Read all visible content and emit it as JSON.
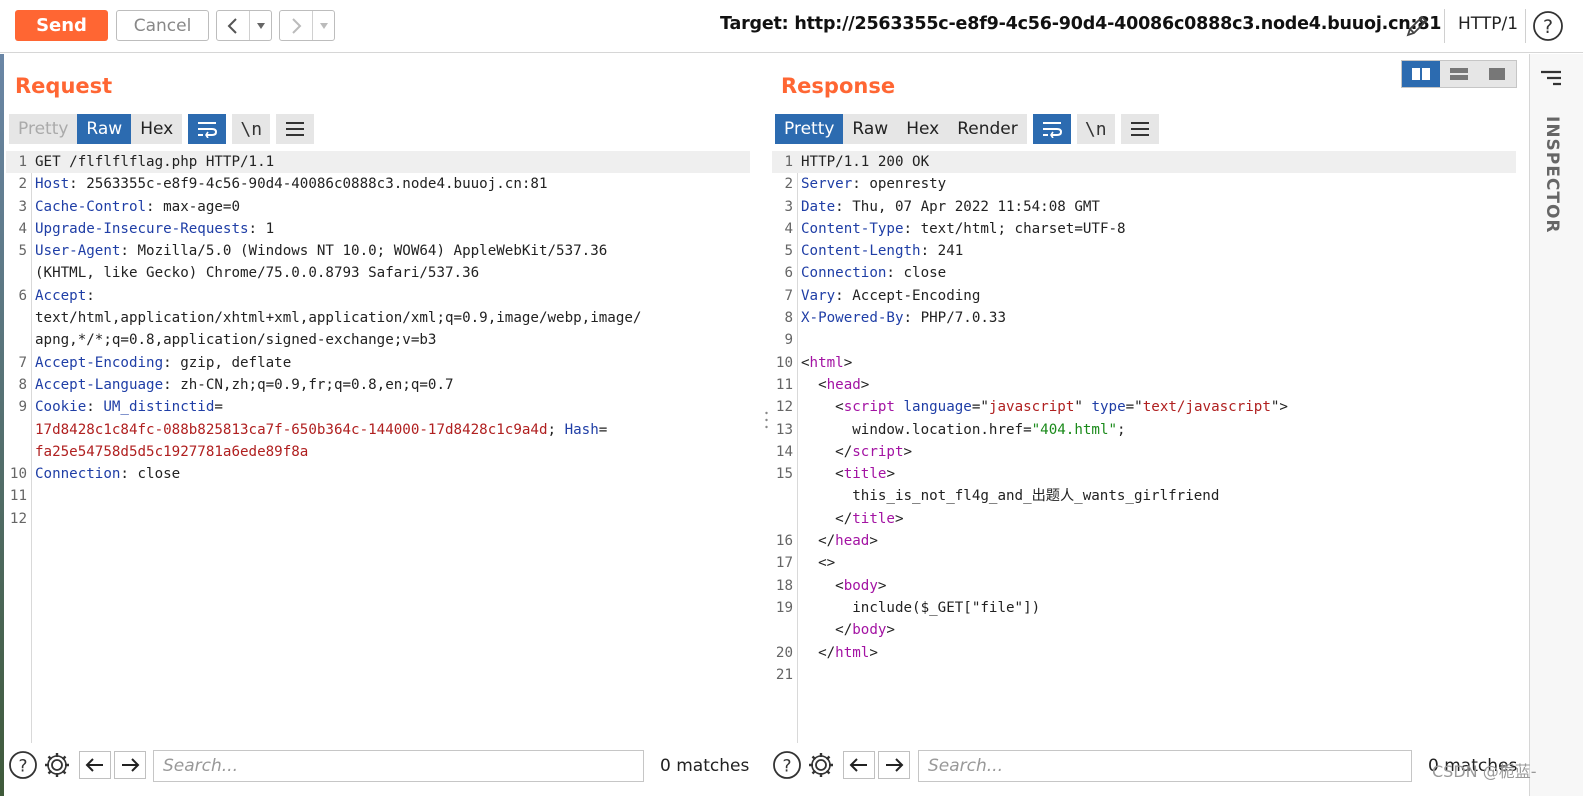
{
  "toolbar": {
    "send_label": "Send",
    "cancel_label": "Cancel",
    "target_label": "Target: http://2563355c-e8f9-4c56-90d4-40086c0888c3.node4.buuoj.cn:81",
    "http_version": "HTTP/1",
    "back_icon": "chevron-left-icon",
    "forward_icon": "chevron-right-icon",
    "edit_icon": "pencil-icon",
    "help_icon": "help-icon"
  },
  "colors": {
    "accent": "#ff6633",
    "active_tab": "#2c6bb0",
    "header_key": "#1f3ea6",
    "cookie_value": "#b02020",
    "tag": "#a313a3",
    "string": "#1a8a1a"
  },
  "request": {
    "title": "Request",
    "tabs": [
      "Pretty",
      "Raw",
      "Hex"
    ],
    "lines": [
      {
        "n": "1",
        "plain": "GET /flflflflag.php HTTP/1.1"
      },
      {
        "n": "2",
        "key": "Host",
        "val": ": 2563355c-e8f9-4c56-90d4-40086c0888c3.node4.buuoj.cn:81"
      },
      {
        "n": "3",
        "key": "Cache-Control",
        "val": ": max-age=0"
      },
      {
        "n": "4",
        "key": "Upgrade-Insecure-Requests",
        "val": ": 1"
      },
      {
        "n": "5",
        "key": "User-Agent",
        "val": ": Mozilla/5.0 (Windows NT 10.0; WOW64) AppleWebKit/537.36"
      },
      {
        "n": "",
        "plain": "(KHTML, like Gecko) Chrome/75.0.0.8793 Safari/537.36"
      },
      {
        "n": "6",
        "key": "Accept",
        "val": ":"
      },
      {
        "n": "",
        "plain": "text/html,application/xhtml+xml,application/xml;q=0.9,image/webp,image/"
      },
      {
        "n": "",
        "plain": "apng,*/*;q=0.8,application/signed-exchange;v=b3"
      },
      {
        "n": "7",
        "key": "Accept-Encoding",
        "val": ": gzip, deflate"
      },
      {
        "n": "8",
        "key": "Accept-Language",
        "val": ": zh-CN,zh;q=0.9,fr;q=0.8,en;q=0.7"
      },
      {
        "n": "9",
        "key": "Cookie",
        "val": ": ",
        "key2": "UM_distinctid",
        "val2": "="
      },
      {
        "n": "",
        "cookie": "17d8428c1c84fc-088b825813ca7f-650b364c-144000-17d8428c1c9a4d",
        "sep": "; ",
        "key3": "Hash",
        "eq": "="
      },
      {
        "n": "",
        "cookie": "fa25e54758d5d5c1927781a6ede89f8a"
      },
      {
        "n": "10",
        "key": "Connection",
        "val": ": close"
      },
      {
        "n": "11",
        "plain": ""
      },
      {
        "n": "12",
        "plain": ""
      }
    ],
    "search_placeholder": "Search...",
    "matches": "0 matches"
  },
  "response": {
    "title": "Response",
    "tabs": [
      "Pretty",
      "Raw",
      "Hex",
      "Render"
    ],
    "lines": [
      {
        "n": "1",
        "plain": "HTTP/1.1 200 OK"
      },
      {
        "n": "2",
        "key": "Server",
        "val": ": openresty"
      },
      {
        "n": "3",
        "key": "Date",
        "val": ": Thu, 07 Apr 2022 11:54:08 GMT"
      },
      {
        "n": "4",
        "key": "Content-Type",
        "val": ": text/html; charset=UTF-8"
      },
      {
        "n": "5",
        "key": "Content-Length",
        "val": ": 241"
      },
      {
        "n": "6",
        "key": "Connection",
        "val": ": close"
      },
      {
        "n": "7",
        "key": "Vary",
        "val": ": Accept-Encoding"
      },
      {
        "n": "8",
        "key": "X-Powered-By",
        "val": ": PHP/7.0.33"
      },
      {
        "n": "9",
        "plain": ""
      },
      {
        "n": "10",
        "html": [
          [
            "p",
            "<"
          ],
          [
            "t",
            "html"
          ],
          [
            "p",
            ">"
          ]
        ]
      },
      {
        "n": "11",
        "html": [
          [
            "p",
            "  <"
          ],
          [
            "t",
            "head"
          ],
          [
            "p",
            ">"
          ]
        ]
      },
      {
        "n": "12",
        "html": [
          [
            "p",
            "    <"
          ],
          [
            "t",
            "script"
          ],
          [
            "p",
            " "
          ],
          [
            "a",
            "language"
          ],
          [
            "p",
            "=\""
          ],
          [
            "v",
            "javascript"
          ],
          [
            "p",
            "\" "
          ],
          [
            "a",
            "type"
          ],
          [
            "p",
            "=\""
          ],
          [
            "v",
            "text/javascript"
          ],
          [
            "p",
            "\">"
          ]
        ]
      },
      {
        "n": "13",
        "html": [
          [
            "p",
            "      window.location.href="
          ],
          [
            "s",
            "\"404.html\""
          ],
          [
            "p",
            ";"
          ]
        ]
      },
      {
        "n": "14",
        "html": [
          [
            "p",
            "    </"
          ],
          [
            "t",
            "script"
          ],
          [
            "p",
            ">"
          ]
        ]
      },
      {
        "n": "15",
        "html": [
          [
            "p",
            "    <"
          ],
          [
            "t",
            "title"
          ],
          [
            "p",
            ">"
          ]
        ]
      },
      {
        "n": "",
        "html": [
          [
            "p",
            "      this_is_not_fl4g_and_出题人_wants_girlfriend"
          ]
        ]
      },
      {
        "n": "",
        "html": [
          [
            "p",
            "    </"
          ],
          [
            "t",
            "title"
          ],
          [
            "p",
            ">"
          ]
        ]
      },
      {
        "n": "16",
        "html": [
          [
            "p",
            "  </"
          ],
          [
            "t",
            "head"
          ],
          [
            "p",
            ">"
          ]
        ]
      },
      {
        "n": "17",
        "html": [
          [
            "p",
            "  <>"
          ]
        ]
      },
      {
        "n": "18",
        "html": [
          [
            "p",
            "    <"
          ],
          [
            "t",
            "body"
          ],
          [
            "p",
            ">"
          ]
        ]
      },
      {
        "n": "19",
        "html": [
          [
            "p",
            "      include($_GET[\"file\"])"
          ]
        ]
      },
      {
        "n": "",
        "html": [
          [
            "p",
            "    </"
          ],
          [
            "t",
            "body"
          ],
          [
            "p",
            ">"
          ]
        ]
      },
      {
        "n": "20",
        "html": [
          [
            "p",
            "  </"
          ],
          [
            "t",
            "html"
          ],
          [
            "p",
            ">"
          ]
        ]
      },
      {
        "n": "21",
        "plain": ""
      }
    ],
    "search_placeholder": "Search...",
    "matches": "0 matches"
  },
  "inspector": {
    "label": "INSPECTOR"
  },
  "watermark": "CSDN @栀蓝-"
}
